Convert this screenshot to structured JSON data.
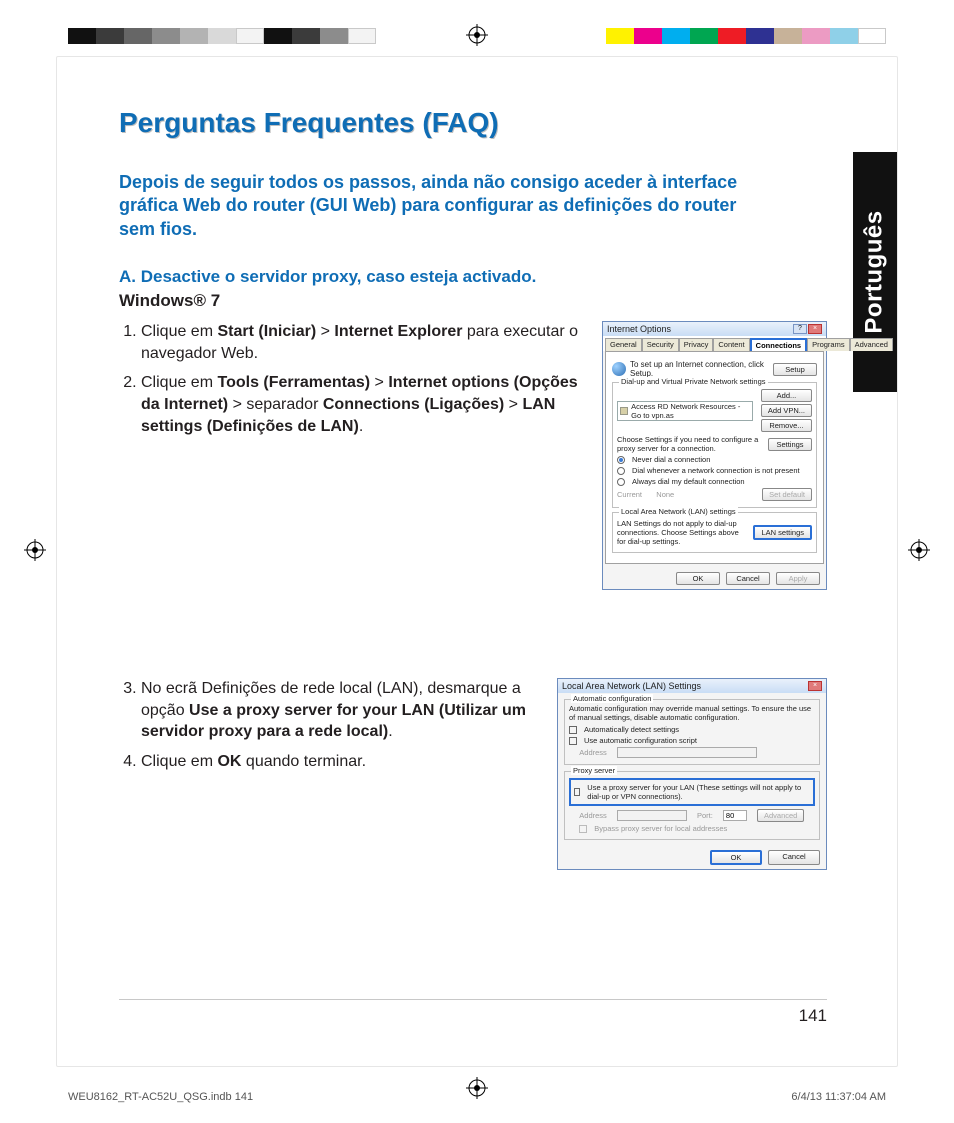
{
  "language_tab": "Português",
  "title": "Perguntas Frequentes (FAQ)",
  "intro": "Depois de seguir todos os passos, ainda não consigo aceder à interface gráfica Web do router (GUI Web) para configurar as definições do router sem fios.",
  "sectionA_label": "A.   Desactive o servidor proxy, caso esteja activado.",
  "os_label": "Windows® 7",
  "step1_pre": "Clique em ",
  "step1_b1": "Start (Iniciar)",
  "step1_gt1": " > ",
  "step1_b2": "Internet Explorer",
  "step1_post": " para executar o navegador Web.",
  "step2_pre": "Clique em ",
  "step2_b1": "Tools (Ferramentas)",
  "step2_gt1": " > ",
  "step2_b2": "Internet options (Opções da Internet)",
  "step2_gt2": " > separador ",
  "step2_b3": "Connections (Ligações)",
  "step2_gt3": " > ",
  "step2_b4": "LAN settings (Definições de LAN)",
  "step2_post": ".",
  "step3_pre": "No ecrã Definições de rede local (LAN), desmarque a opção ",
  "step3_b1": "Use a proxy server for your LAN (Utilizar um servidor proxy para a rede local)",
  "step3_post": ".",
  "step4_pre": "Clique em ",
  "step4_b1": "OK",
  "step4_post": " quando terminar.",
  "dlg1": {
    "title": "Internet Options",
    "tabs": {
      "general": "General",
      "security": "Security",
      "privacy": "Privacy",
      "content": "Content",
      "connections": "Connections",
      "programs": "Programs",
      "advanced": "Advanced"
    },
    "setup_text1": "To set up an Internet connection, click",
    "setup_text2": "Setup.",
    "setup_btn": "Setup",
    "vpn_legend": "Dial-up and Virtual Private Network settings",
    "vpn_item": "Access RD Network Resources - Go to vpn.as",
    "add": "Add...",
    "addvpn": "Add VPN...",
    "remove": "Remove...",
    "choose_text": "Choose Settings if you need to configure a proxy server for a connection.",
    "settings": "Settings",
    "never": "Never dial a connection",
    "dialwhen": "Dial whenever a network connection is not present",
    "always": "Always dial my default connection",
    "current": "Current",
    "none": "None",
    "setdefault": "Set default",
    "lan_legend": "Local Area Network (LAN) settings",
    "lan_text": "LAN Settings do not apply to dial-up connections. Choose Settings above for dial-up settings.",
    "lan_btn": "LAN settings",
    "ok": "OK",
    "cancel": "Cancel",
    "apply": "Apply"
  },
  "dlg2": {
    "title": "Local Area Network (LAN) Settings",
    "auto_legend": "Automatic configuration",
    "auto_text": "Automatic configuration may override manual settings. To ensure the use of manual settings, disable automatic configuration.",
    "auto_detect": "Automatically detect settings",
    "auto_script": "Use automatic configuration script",
    "address": "Address",
    "proxy_legend": "Proxy server",
    "proxy_use": "Use a proxy server for your LAN (These settings will not apply to dial-up or VPN connections).",
    "port": "Port:",
    "port_val": "80",
    "advanced": "Advanced",
    "bypass": "Bypass proxy server for local addresses",
    "ok": "OK",
    "cancel": "Cancel"
  },
  "page_number": "141",
  "footer": {
    "left": "WEU8162_RT-AC52U_QSG.indb   141",
    "right": "6/4/13   11:37:04 AM"
  }
}
